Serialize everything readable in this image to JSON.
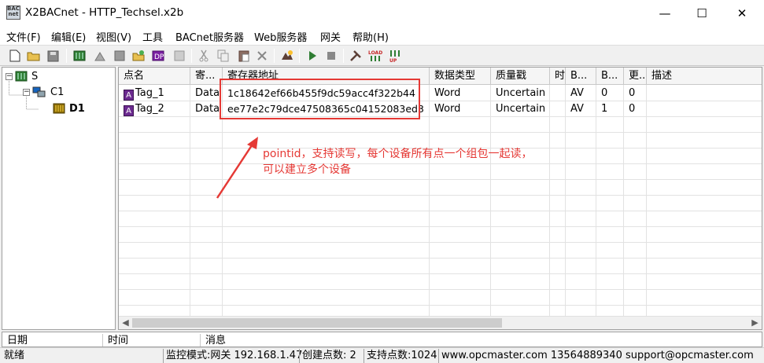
{
  "window": {
    "title": "X2BACnet - HTTP_Techsel.x2b",
    "icon_text": [
      "BAC",
      "net"
    ],
    "minimize": "—",
    "maximize": "☐",
    "close": "✕"
  },
  "menu": [
    "文件(F)",
    "编辑(E)",
    "视图(V)",
    "工具",
    "BACnet服务器",
    "Web服务器",
    "网关",
    "帮助(H)"
  ],
  "toolbar": {
    "icons": [
      "new-file-icon",
      "open-folder-icon",
      "save-icon",
      "add-server-icon",
      "add-channel-icon",
      "add-device-icon",
      "add-tag-icon",
      "add-many-icon",
      "properties-icon",
      "cut-icon",
      "copy-icon",
      "paste-icon",
      "delete-icon",
      "monitor-icon",
      "start-icon",
      "stop-icon",
      "tools-icon",
      "load-icon",
      "upload-icon"
    ]
  },
  "tree": {
    "root": "S",
    "channel": "C1",
    "device": "D1",
    "expander_open": "−"
  },
  "grid": {
    "columns": [
      "点名",
      "寄...",
      "寄存器地址",
      "数据类型",
      "质量戳",
      "时",
      "B...",
      "B...",
      "更...",
      "描述"
    ],
    "rows": [
      {
        "name": "Tag_1",
        "reg": "Data",
        "address": "1c18642ef66b455f9dc59acc4f322b44",
        "type": "Word",
        "quality": "Uncertain",
        "time": "",
        "b1": "AV",
        "b2": "0",
        "update": "0",
        "desc": ""
      },
      {
        "name": "Tag_2",
        "reg": "Data",
        "address": "ee77e2c79dce47508365c04152083ed3",
        "type": "Word",
        "quality": "Uncertain",
        "time": "",
        "b1": "AV",
        "b2": "1",
        "update": "0",
        "desc": ""
      }
    ],
    "tag_icon_letter": "A"
  },
  "annotation": {
    "line1": "pointid，支持读写，每个设备所有点一个组包一起读，",
    "line2": "可以建立多个设备",
    "color": "#e53935"
  },
  "log": {
    "columns": [
      "日期",
      "时间",
      "消息"
    ]
  },
  "status": {
    "ready": "就绪",
    "mode": "监控模式:网关 192.168.1.47",
    "created": "创建点数:  2",
    "supported": "支持点数:1024",
    "contact": "www.opcmaster.com 13564889340 support@opcmaster.com"
  }
}
